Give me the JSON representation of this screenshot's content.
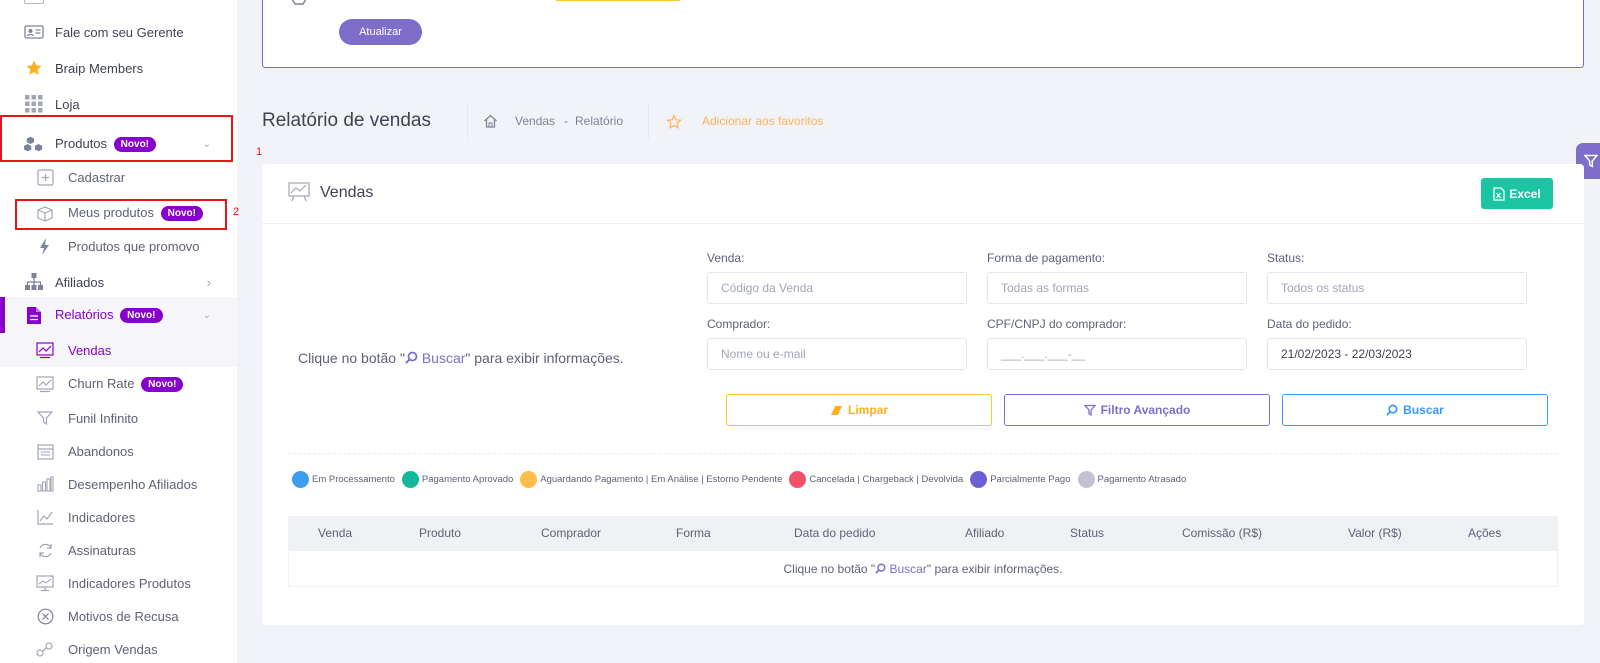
{
  "sidebar": {
    "items": [
      {
        "label": "Fale com seu Gerente",
        "icon": "id-card-icon"
      },
      {
        "label": "Braip Members",
        "icon": "star-icon"
      },
      {
        "label": "Loja",
        "icon": "grid-icon"
      },
      {
        "label": "Produtos",
        "icon": "boxes-icon",
        "badge": "Novo!"
      },
      {
        "label": "Cadastrar",
        "icon": "plus-square-icon"
      },
      {
        "label": "Meus produtos",
        "icon": "box-icon",
        "badge": "Novo!"
      },
      {
        "label": "Produtos que promovo",
        "icon": "lightning-icon"
      },
      {
        "label": "Afiliados",
        "icon": "network-icon"
      },
      {
        "label": "Relatórios",
        "icon": "document-icon",
        "badge": "Novo!"
      },
      {
        "label": "Vendas",
        "icon": "chart-line-icon"
      },
      {
        "label": "Churn Rate",
        "icon": "chart-line-icon",
        "badge": "Novo!"
      },
      {
        "label": "Funil Infinito",
        "icon": "funnel-icon"
      },
      {
        "label": "Abandonos",
        "icon": "calendar-icon"
      },
      {
        "label": "Desempenho Afiliados",
        "icon": "bar-chart-icon"
      },
      {
        "label": "Indicadores",
        "icon": "area-chart-icon"
      },
      {
        "label": "Assinaturas",
        "icon": "refresh-icon"
      },
      {
        "label": "Indicadores Produtos",
        "icon": "monitor-chart-icon"
      },
      {
        "label": "Motivos de Recusa",
        "icon": "x-circle-icon"
      },
      {
        "label": "Origem Vendas",
        "icon": "origin-icon"
      }
    ],
    "annotations": [
      "1",
      "2"
    ]
  },
  "top_card": {
    "update_button": "Atualizar"
  },
  "header": {
    "title": "Relatório de vendas",
    "breadcrumb_1": "Vendas",
    "breadcrumb_sep": "-",
    "breadcrumb_2": "Relatório",
    "favorite": "Adicionar aos favoritos"
  },
  "card": {
    "title": "Vendas",
    "excel_button": "Excel",
    "empty_prefix": "Clique no botão \"",
    "empty_link": "Buscar",
    "empty_suffix": "\" para exibir informações."
  },
  "filters": {
    "venda_label": "Venda:",
    "venda_placeholder": "Código da Venda",
    "pagamento_label": "Forma de pagamento:",
    "pagamento_placeholder": "Todas as formas",
    "status_label": "Status:",
    "status_placeholder": "Todos os status",
    "comprador_label": "Comprador:",
    "comprador_placeholder": "Nome ou e-mail",
    "cpf_label": "CPF/CNPJ do comprador:",
    "cpf_placeholder": "___.___.___-__",
    "data_label": "Data do pedido:",
    "data_value": "21/02/2023 - 22/03/2023",
    "limpar": "Limpar",
    "filtro": "Filtro Avançado",
    "buscar": "Buscar"
  },
  "legend": [
    {
      "label": "Em Processamento",
      "color": "#3b9ff0"
    },
    {
      "label": "Pagamento Aprovado",
      "color": "#12b89a"
    },
    {
      "label": "Aguardando Pagamento | Em Análise | Estorno Pendente",
      "color": "#ffbd4a"
    },
    {
      "label": "Cancelada | Chargeback | Devolvida",
      "color": "#f1516a"
    },
    {
      "label": "Parcialmente Pago",
      "color": "#6c5fd6"
    },
    {
      "label": "Pagamento Atrasado",
      "color": "#c3c2d2"
    }
  ],
  "table": {
    "columns": [
      "Venda",
      "Produto",
      "Comprador",
      "Forma",
      "Data do pedido",
      "Afiliado",
      "Status",
      "Comissão (R$)",
      "Valor (R$)",
      "Ações"
    ]
  },
  "colors": {
    "accent": "#8800cc",
    "primary": "#7f6ec9",
    "success": "#1bc5a3",
    "warning": "#ffc33b",
    "info": "#3699ff"
  }
}
